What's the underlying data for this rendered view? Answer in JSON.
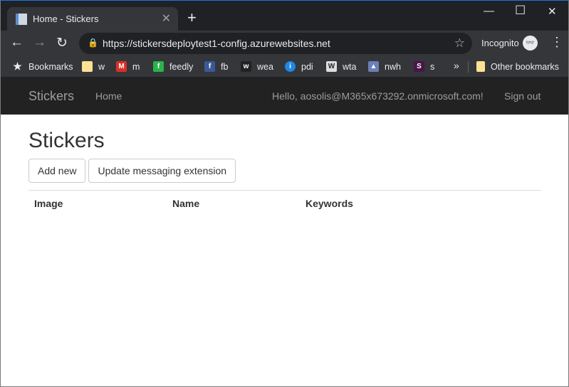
{
  "browser": {
    "tab_title": "Home - Stickers",
    "url": "https://stickersdeploytest1-config.azurewebsites.net",
    "profile": "Incognito",
    "bookmarks": [
      {
        "label": "Bookmarks",
        "icon": "star-icon",
        "color": "#e8eaed"
      },
      {
        "label": "w",
        "icon": "folder-icon",
        "color": "#fde293"
      },
      {
        "label": "m",
        "icon": "gmail-icon",
        "color": "#d93025"
      },
      {
        "label": "feedly",
        "icon": "feedly-icon",
        "color": "#2bb24c"
      },
      {
        "label": "fb",
        "icon": "facebook-icon",
        "color": "#3b5998"
      },
      {
        "label": "wea",
        "icon": "wunderground-icon",
        "color": "#222"
      },
      {
        "label": "pdi",
        "icon": "pdi-icon",
        "color": "#1e88e5"
      },
      {
        "label": "wta",
        "icon": "wta-icon",
        "color": "#ddd"
      },
      {
        "label": "nwh",
        "icon": "hiker-icon",
        "color": "#6b7fb8"
      },
      {
        "label": "s",
        "icon": "s-icon",
        "color": "#4a154b"
      }
    ],
    "other_bookmarks": "Other bookmarks"
  },
  "navbar": {
    "brand": "Stickers",
    "home": "Home",
    "greeting": "Hello, aosolis@M365x673292.onmicrosoft.com!",
    "sign_out": "Sign out"
  },
  "page": {
    "title": "Stickers",
    "add_new": "Add new",
    "update": "Update messaging extension",
    "columns": [
      "Image",
      "Name",
      "Keywords"
    ]
  }
}
